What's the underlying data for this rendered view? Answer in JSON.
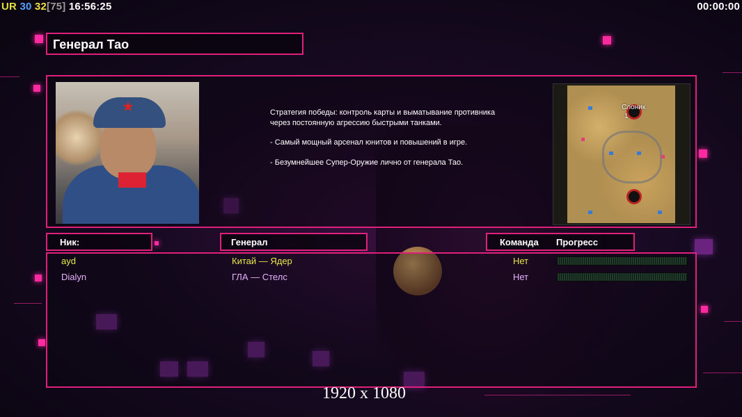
{
  "hud": {
    "ur": "UR",
    "n30": "30",
    "n32": "32",
    "bracket": "[75]",
    "clock": "16:56:25",
    "timer": "00:00:00"
  },
  "general_title": "Генерал Тао",
  "description": {
    "p1": "Стратегия победы: контроль карты и выматывание противника через постоянную агрессию быстрыми танками.",
    "p2": "- Самый мощный арсенал юнитов и повышений в игре.",
    "p3": "- Безумнейшее Супер-Оружие лично от генерала Тао."
  },
  "map": {
    "name": "Слоник",
    "player_number": "1"
  },
  "table": {
    "headers": {
      "nick": "Ник:",
      "general": "Генерал",
      "team": "Команда",
      "progress": "Прогресс"
    },
    "rows": [
      {
        "nick": "ayd",
        "general": "Китай — Ядер",
        "team": "Нет",
        "color": "#e8e84a"
      },
      {
        "nick": "Dialyn",
        "general": "ГЛА — Стелс",
        "team": "Нет",
        "color": "#e8b0ff"
      }
    ]
  },
  "resolution_caption": "1920 x 1080",
  "colors": {
    "accent": "#e0207a",
    "player1": "#e8e84a",
    "player2": "#e8b0ff"
  }
}
